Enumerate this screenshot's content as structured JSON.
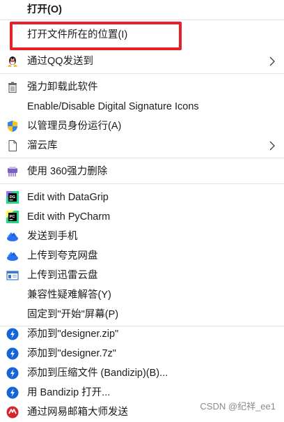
{
  "menu": {
    "open": "打开(O)",
    "open_location": "打开文件所在的位置(I)",
    "send_qq": "通过QQ发送到",
    "force_uninstall": "强力卸载此软件",
    "signature_icons": "Enable/Disable Digital Signature Icons",
    "run_as_admin": "以管理员身份运行(A)",
    "liuyun": "溜云库",
    "delete_360": "使用 360强力删除",
    "edit_datagrip": "Edit with DataGrip",
    "edit_pycharm": "Edit with PyCharm",
    "send_phone": "发送到手机",
    "upload_quark": "上传到夸克网盘",
    "upload_xunlei": "上传到迅雷云盘",
    "compat": "兼容性疑难解答(Y)",
    "pin_start": "固定到\"开始\"屏幕(P)",
    "add_zip": "添加到\"designer.zip\"",
    "add_7z": "添加到\"designer.7z\"",
    "add_archive": "添加到压缩文件 (Bandizip)(B)...",
    "open_bandizip": "用 Bandizip 打开...",
    "send_netease": "通过网易邮箱大师发送"
  },
  "watermark": "CSDN @纪祥_ee1",
  "colors": {
    "highlight_border": "#e8202a",
    "separator": "#e3e3e3",
    "bandizip_blue": "#1565d8",
    "netease_red": "#d4252b"
  }
}
